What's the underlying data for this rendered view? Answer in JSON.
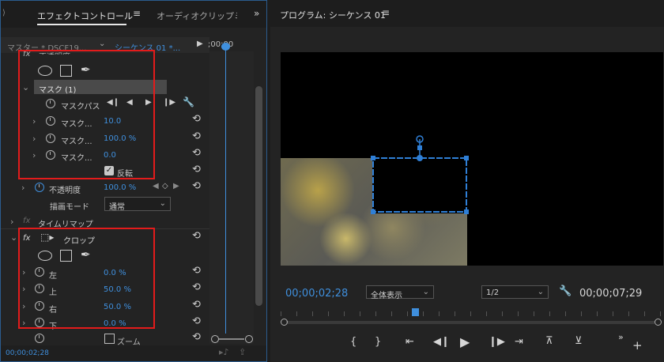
{
  "left_panel": {
    "tabs": {
      "effect_controls": "エフェクトコントロール",
      "audio_mixer": "オーディオクリップミ"
    },
    "header": {
      "master": "マスター * DSCF19...",
      "sequence": "シーケンス 01 *...",
      "time": ";00;00"
    },
    "opacity_partial": "不透明度",
    "mask_label": "マスク (1)",
    "mask_path": "マスクパス",
    "mask_props": [
      {
        "label": "マスク...",
        "value": "10.0"
      },
      {
        "label": "マスク...",
        "value": "100.0 %"
      },
      {
        "label": "マスク...",
        "value": "0.0"
      }
    ],
    "inverted_label": "反転",
    "opacity": {
      "label": "不透明度",
      "value": "100.0 %"
    },
    "blend_mode": {
      "label": "描画モード",
      "value": "通常"
    },
    "time_remap": "タイムリマップ",
    "crop": {
      "fx": "fx",
      "label": "クロップ"
    },
    "crop_props": [
      {
        "label": "左",
        "value": "0.0 %"
      },
      {
        "label": "上",
        "value": "50.0 %"
      },
      {
        "label": "右",
        "value": "50.0 %"
      },
      {
        "label": "下",
        "value": "0.0 %"
      }
    ],
    "zoom_label": "ズーム",
    "timecode": "00;00;02;28"
  },
  "program_monitor": {
    "title": "プログラム: シーケンス 01",
    "timecode_current": "00;00;02;28",
    "zoom_select": "全体表示",
    "resolution_select": "1/2",
    "timecode_duration": "00;00;07;29"
  },
  "colors": {
    "accent": "#3f8fdd",
    "highlight_box": "#e31b1b",
    "mask_outline": "#2f7fd6"
  }
}
